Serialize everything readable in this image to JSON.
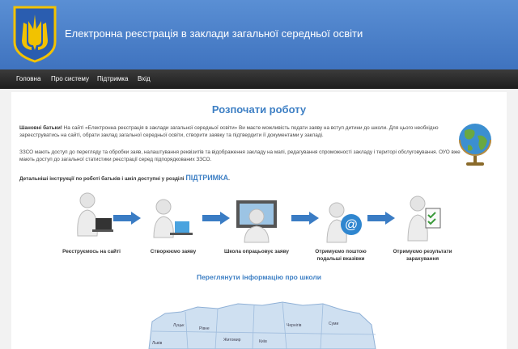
{
  "header": {
    "title": "Електронна реєстрація в заклади загальної середньої освіти",
    "brand_color": "#4a82cc"
  },
  "nav": {
    "items": [
      "Головна",
      "Про систему",
      "Підтримка",
      "Вхід"
    ]
  },
  "main": {
    "heading": "Розпочати роботу",
    "p1_bold": "Шановні батьки!",
    "p1_text": " На сайті «Електронна реєстрація в заклади загальної середньої освіти» Ви маєте можливість подати заяву на вступ дитини до школи. Для цього необхідно зареєструватись на сайті, обрати заклад загальної середньої освіти, створити заявку та підтвердити її документами у закладі.",
    "p2_text": "ЗЗСО мають доступ до перегляду та обробки заяв, налаштування реквізитів та відображення закладу на мапі, редагування спроможності закладу і територі обслуговування. ОУО вже мають доступ до загальної статистики реєстрації серед підпорядкованих ЗЗСО.",
    "p3_text": "Детальніші інструкції по роботі батьків і шкіл доступні у розділі ",
    "p3_link": "ПІДТРИМКА",
    "p3_end": ".",
    "steps": [
      {
        "label": "Реєструємось на сайті"
      },
      {
        "label": "Створюємо заяву"
      },
      {
        "label": "Школа опрацьовує заяву"
      },
      {
        "label": "Отримуємо поштою подальші вказівки"
      },
      {
        "label": "Отримуємо результати зарахування"
      }
    ],
    "map_heading": "Переглянути інформацію про школи",
    "map_regions": [
      "Луцьк",
      "Рівне",
      "Житомир",
      "Київ",
      "Чернігів",
      "Суми",
      "Львів"
    ]
  }
}
